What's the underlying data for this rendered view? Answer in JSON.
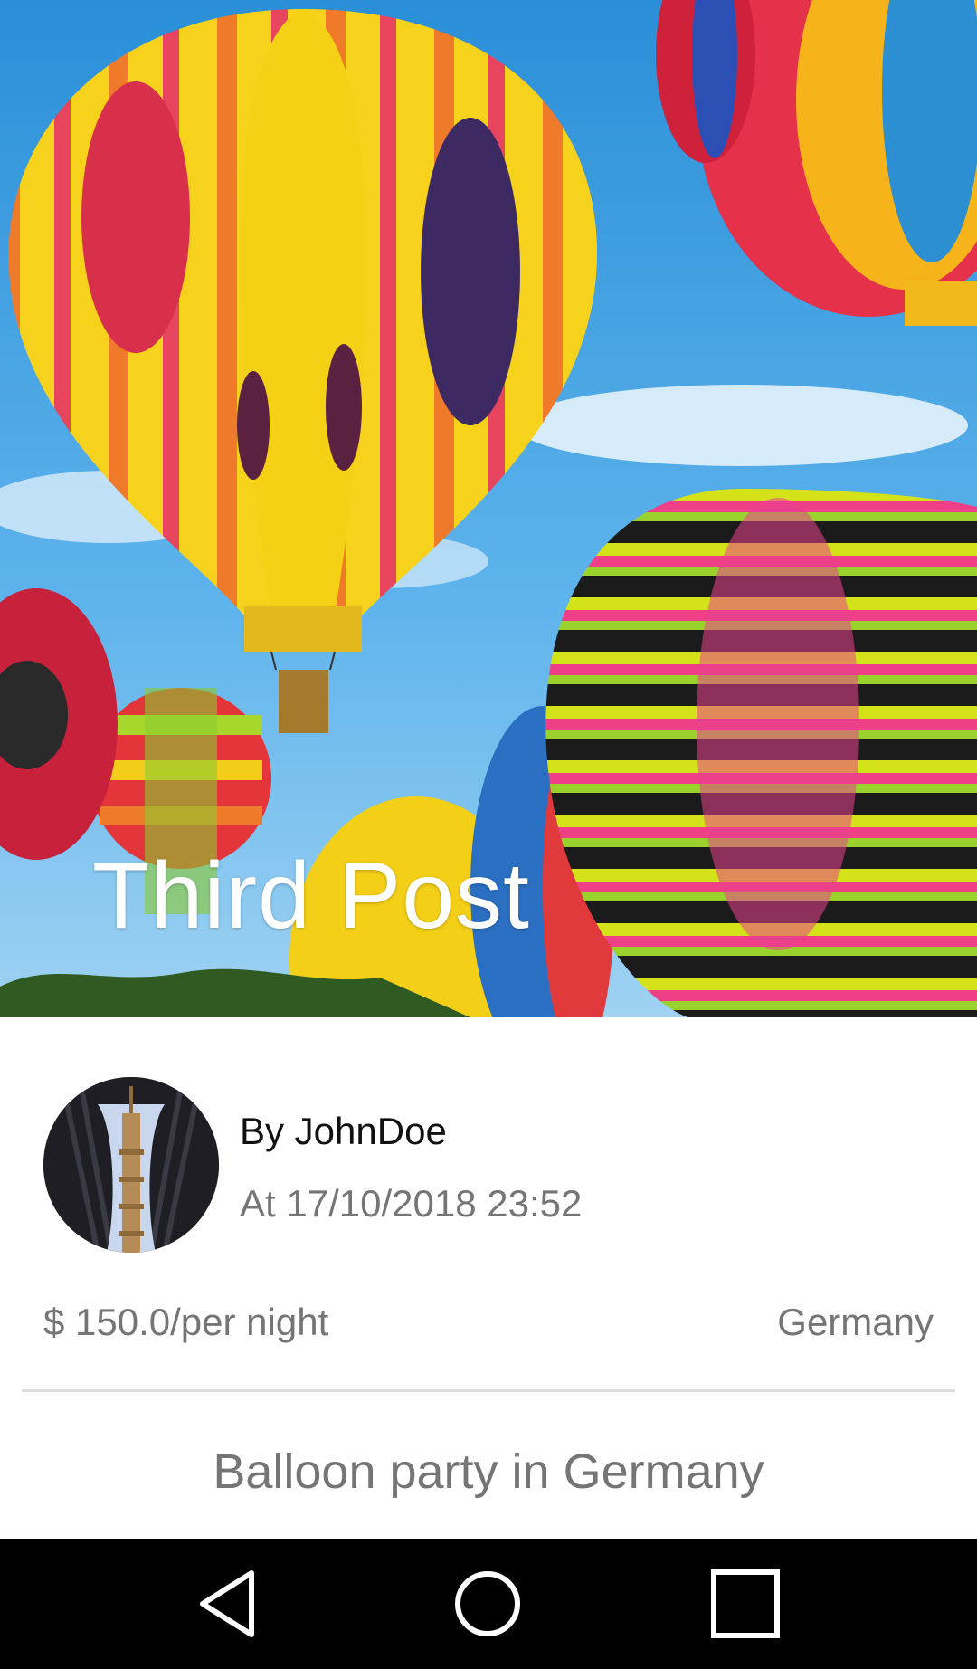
{
  "post": {
    "title": "Third Post",
    "author": "By JohnDoe",
    "date": "At 17/10/2018 23:52",
    "price": "$ 150.0/per night",
    "location": "Germany",
    "description": "Balloon party in Germany"
  },
  "hero_image": {
    "subject": "hot-air-balloons-photo"
  },
  "avatar_image": {
    "subject": "tower-photo"
  },
  "navbar": {
    "back_icon": "back-triangle-icon",
    "home_icon": "home-circle-icon",
    "recents_icon": "recents-square-icon"
  },
  "colors": {
    "sky": "#3ea0e0",
    "secondary_text": "#757575",
    "primary_text": "#111111",
    "navbar": "#000000"
  }
}
